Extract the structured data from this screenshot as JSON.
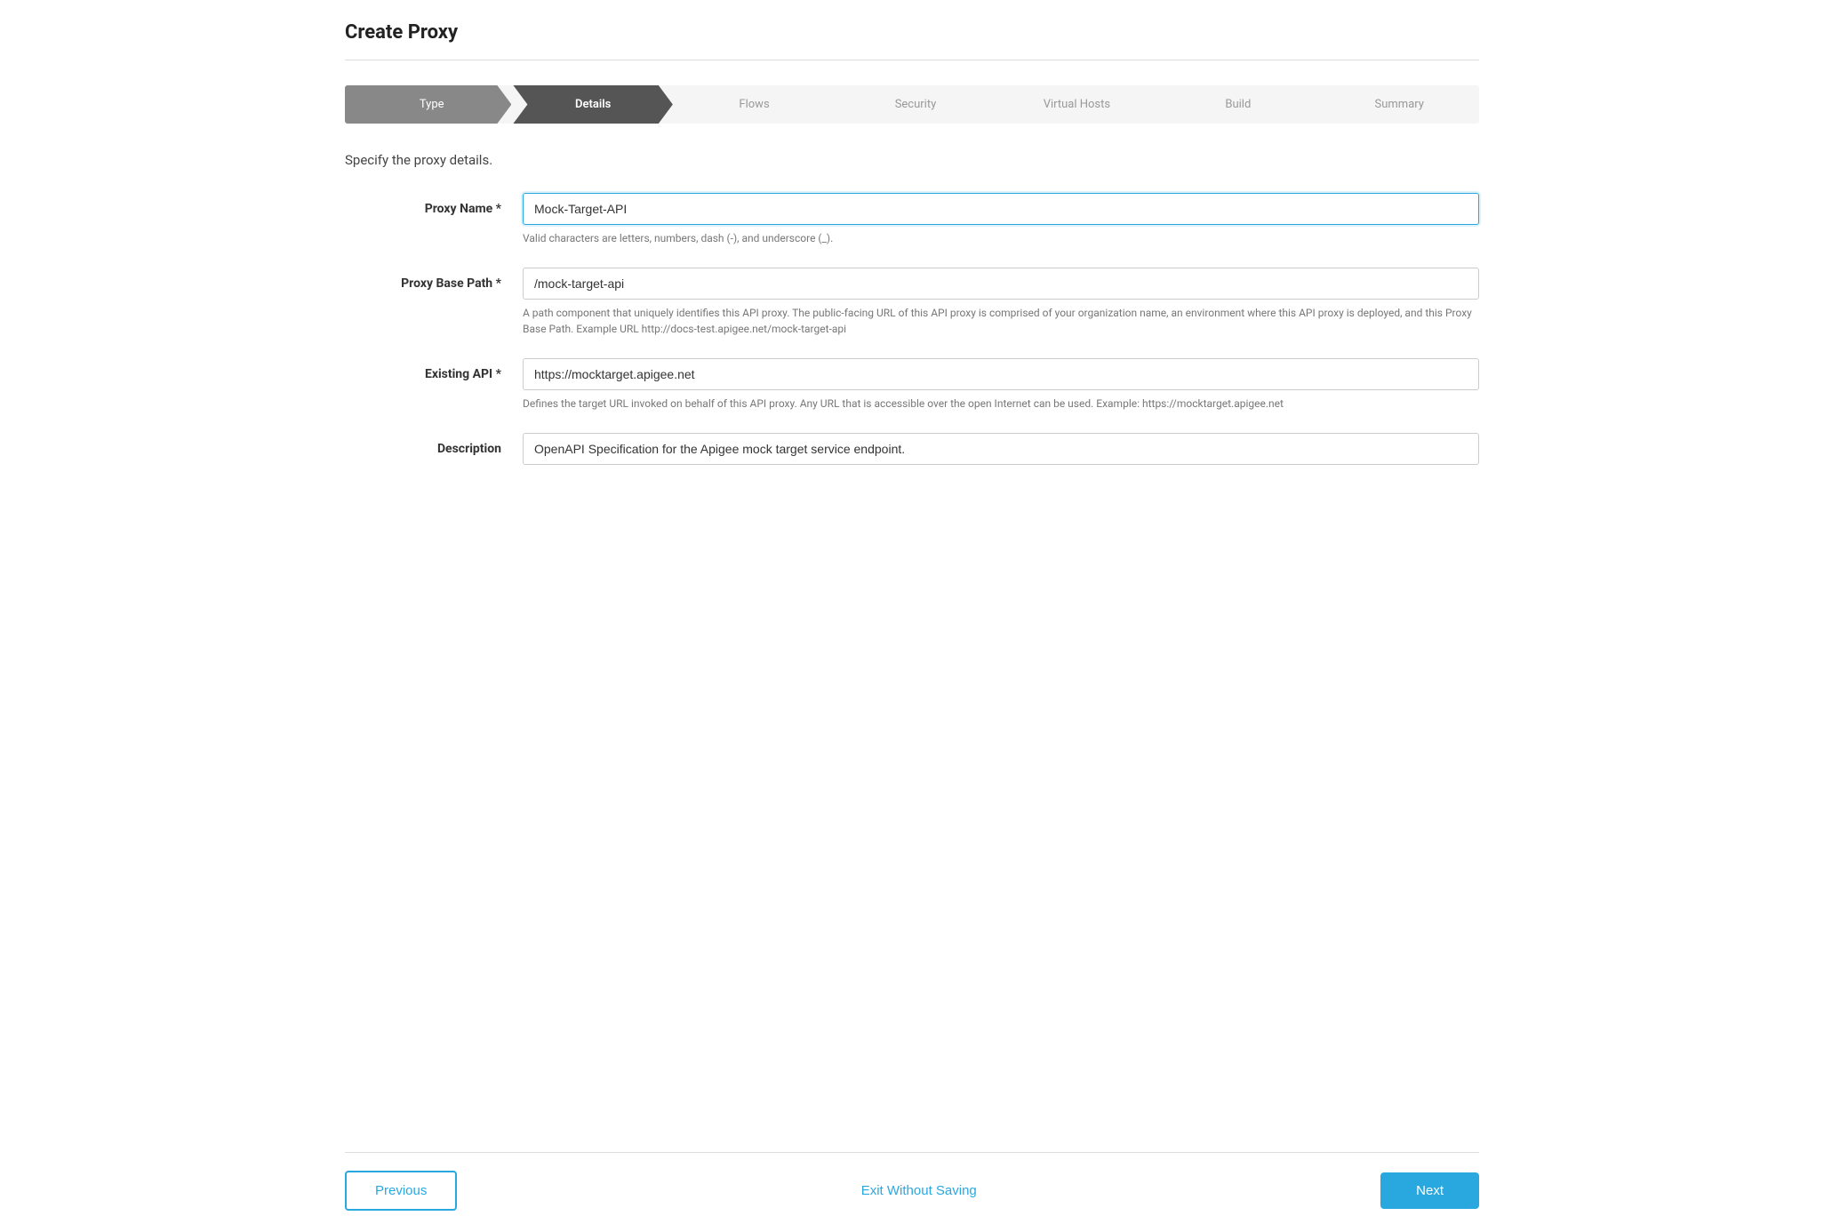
{
  "page": {
    "title": "Create Proxy"
  },
  "stepper": {
    "steps": [
      {
        "id": "type",
        "label": "Type",
        "state": "completed"
      },
      {
        "id": "details",
        "label": "Details",
        "state": "active"
      },
      {
        "id": "flows",
        "label": "Flows",
        "state": "inactive"
      },
      {
        "id": "security",
        "label": "Security",
        "state": "inactive"
      },
      {
        "id": "virtual-hosts",
        "label": "Virtual Hosts",
        "state": "inactive"
      },
      {
        "id": "build",
        "label": "Build",
        "state": "inactive"
      },
      {
        "id": "summary",
        "label": "Summary",
        "state": "inactive"
      }
    ]
  },
  "form": {
    "section_description": "Specify the proxy details.",
    "fields": {
      "proxy_name": {
        "label": "Proxy Name",
        "required": true,
        "value": "Mock-Target-API",
        "hint": "Valid characters are letters, numbers, dash (-), and underscore (_).",
        "active": true
      },
      "proxy_base_path": {
        "label": "Proxy Base Path",
        "required": true,
        "value": "/mock-target-api",
        "hint": "A path component that uniquely identifies this API proxy. The public-facing URL of this API proxy is comprised of your organization name, an environment where this API proxy is deployed, and this Proxy Base Path. Example URL http://docs-test.apigee.net/mock-target-api"
      },
      "existing_api": {
        "label": "Existing API",
        "required": true,
        "value": "https://mocktarget.apigee.net",
        "hint": "Defines the target URL invoked on behalf of this API proxy. Any URL that is accessible over the open Internet can be used. Example: https://mocktarget.apigee.net"
      },
      "description": {
        "label": "Description",
        "required": false,
        "value": "OpenAPI Specification for the Apigee mock target service endpoint."
      }
    }
  },
  "footer": {
    "previous_label": "Previous",
    "exit_label": "Exit Without Saving",
    "next_label": "Next"
  }
}
